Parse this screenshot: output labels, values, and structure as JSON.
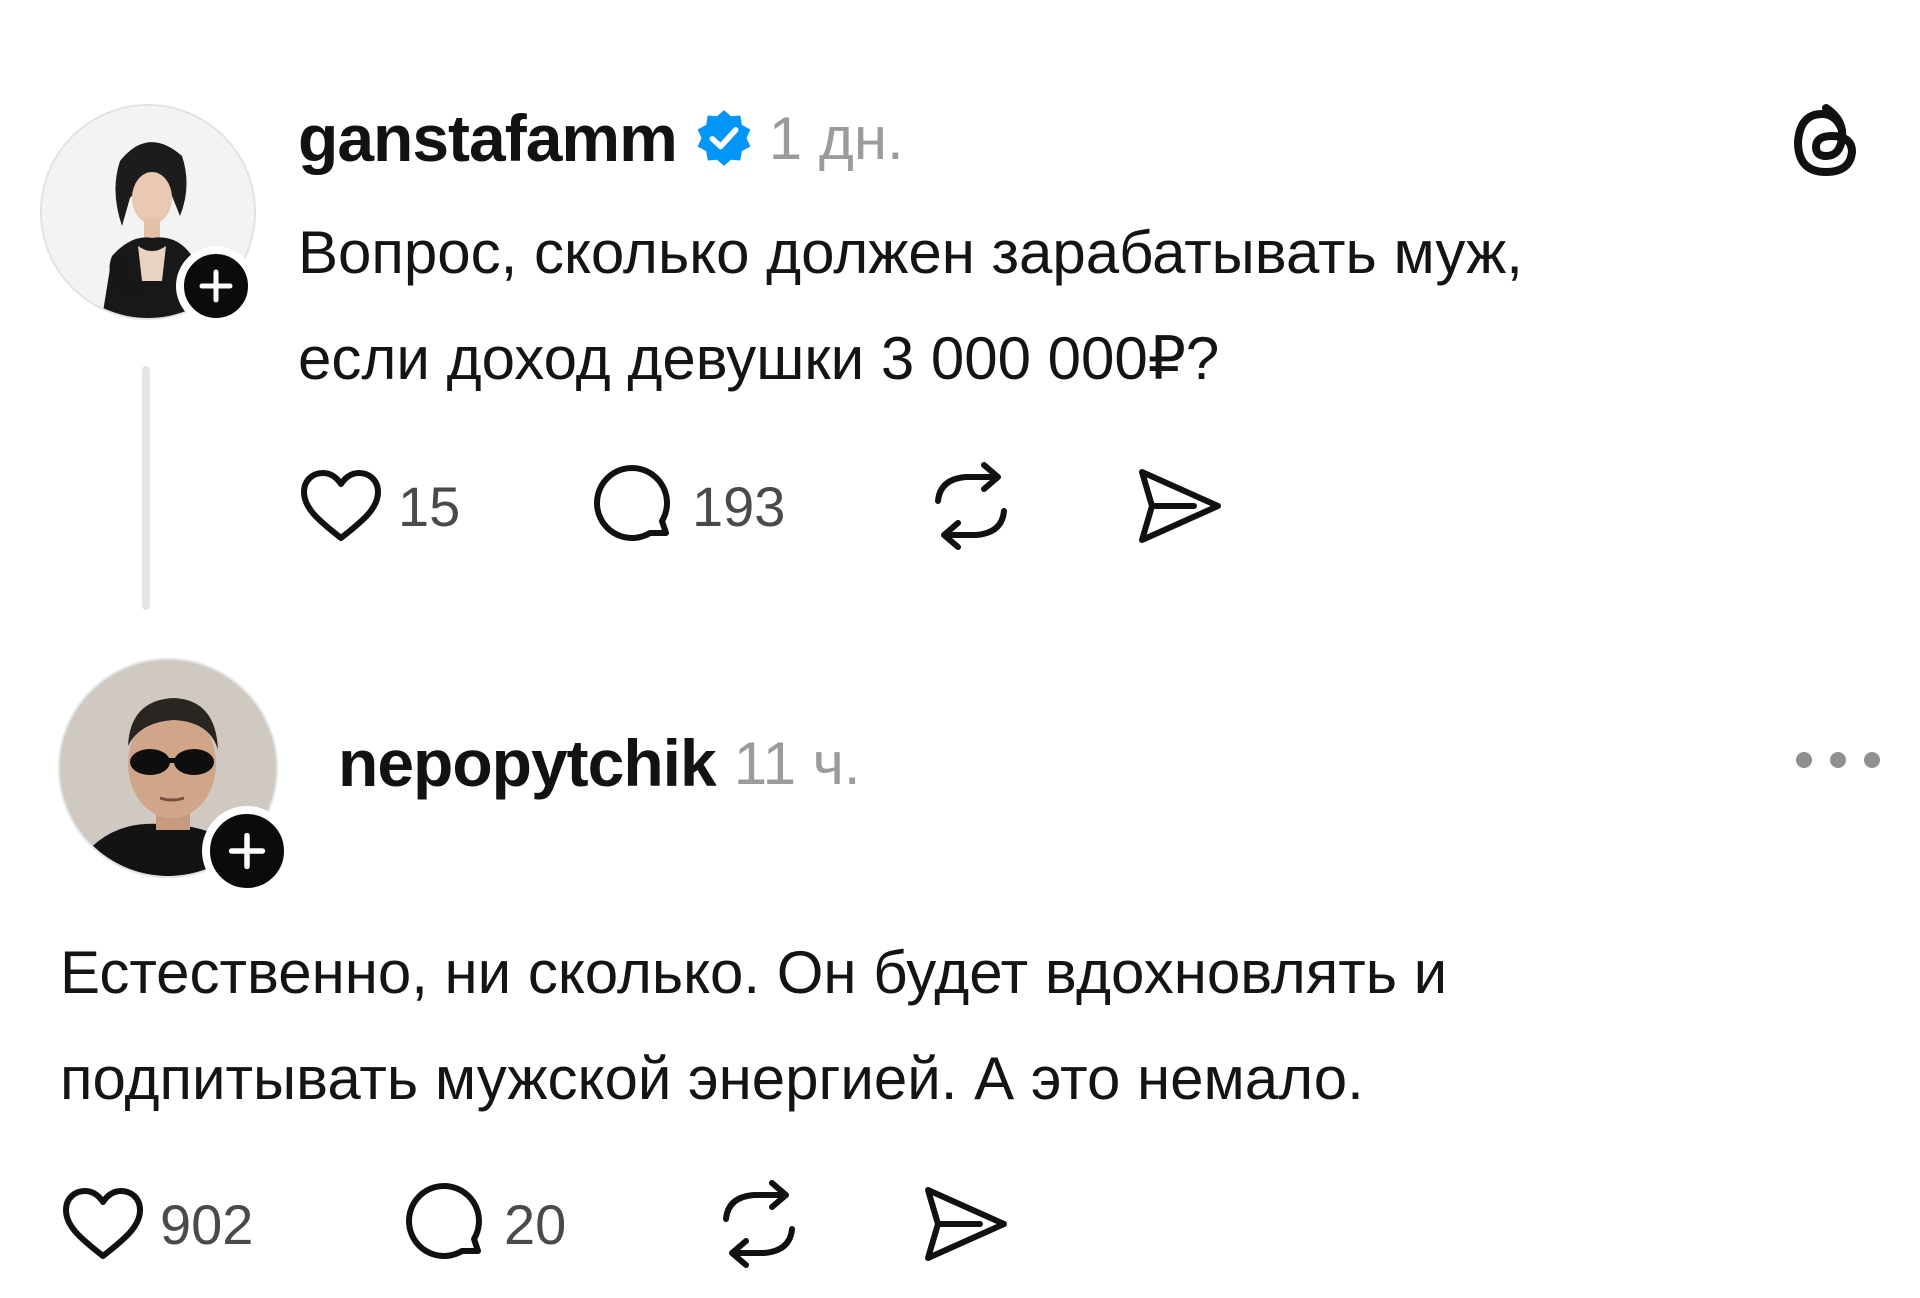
{
  "post": {
    "username": "ganstafamm",
    "verified": true,
    "time": "1 дн.",
    "text_lines": [
      "Вопрос, сколько должен зарабатывать муж,",
      "если доход девушки 3 000 000₽?"
    ],
    "likes": "15",
    "comments": "193",
    "app_icon": "threads-logo-icon",
    "verified_color": "#0095f6"
  },
  "reply": {
    "username": "nepopytchik",
    "time": "11 ч.",
    "text_lines": [
      "Естественно, ни сколько. Он будет вдохновлять и",
      "подпитывать мужской энергией. А это немало."
    ],
    "likes": "902",
    "comments": "20",
    "menu_icon": "more-options-icon"
  }
}
